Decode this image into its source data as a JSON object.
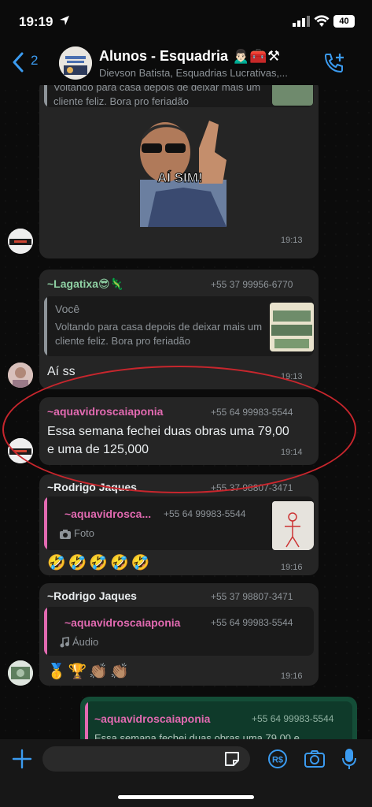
{
  "status": {
    "time": "19:19",
    "battery": "40"
  },
  "header": {
    "back_count": "2",
    "title": "Alunos - Esquadria 🙍🏻‍♂️🧰⚒",
    "subtitle": "Dievson Batista, Esquadrias Lucrativas,..."
  },
  "messages": {
    "m1": {
      "quote_text": "Voltando para casa depois de deixar mais um cliente feliz. Bora pro feriadão",
      "sticker_caption": "AÍ SIM!",
      "time": "19:13"
    },
    "m2": {
      "sender": "~Lagatixa😎🦎",
      "phone": "+55 37 99956-6770",
      "quote_author": "Você",
      "quote_text": "Voltando para casa depois de deixar mais um cliente feliz. Bora pro feriadão",
      "text": "Aí ss",
      "time": "19:13"
    },
    "m3": {
      "sender": "~aquavidroscaiaponia",
      "phone": "+55 64 99983-5544",
      "text": "Essa semana fechei duas obras  uma 79,00 e uma de 125,000",
      "time": "19:14"
    },
    "m4": {
      "sender": "~Rodrigo Jaques",
      "phone": "+55 37 98807-3471",
      "quote_author": "~aquavidrosca...",
      "quote_phone": "+55 64 99983-5544",
      "quote_text": "Foto",
      "text": "🤣🤣🤣🤣🤣",
      "time": "19:16"
    },
    "m5": {
      "sender": "~Rodrigo Jaques",
      "phone": "+55 37 98807-3471",
      "quote_author": "~aquavidroscaiaponia",
      "quote_phone": "+55 64 99983-5544",
      "quote_text": "Áudio",
      "text": "🥇🏆👏🏽👏🏽",
      "time": "19:16"
    },
    "m6": {
      "quote_author": "~aquavidroscaiaponia",
      "quote_phone": "+55 64 99983-5544",
      "quote_text": "Essa semana fechei duas obras  uma 79,00 e"
    }
  },
  "colors": {
    "accent_blue": "#3b9bf0",
    "sender_green": "#8fd1a4",
    "sender_pink": "#e26ab1",
    "outgoing_bubble": "#144d37",
    "annotation_red": "#c8262d"
  }
}
